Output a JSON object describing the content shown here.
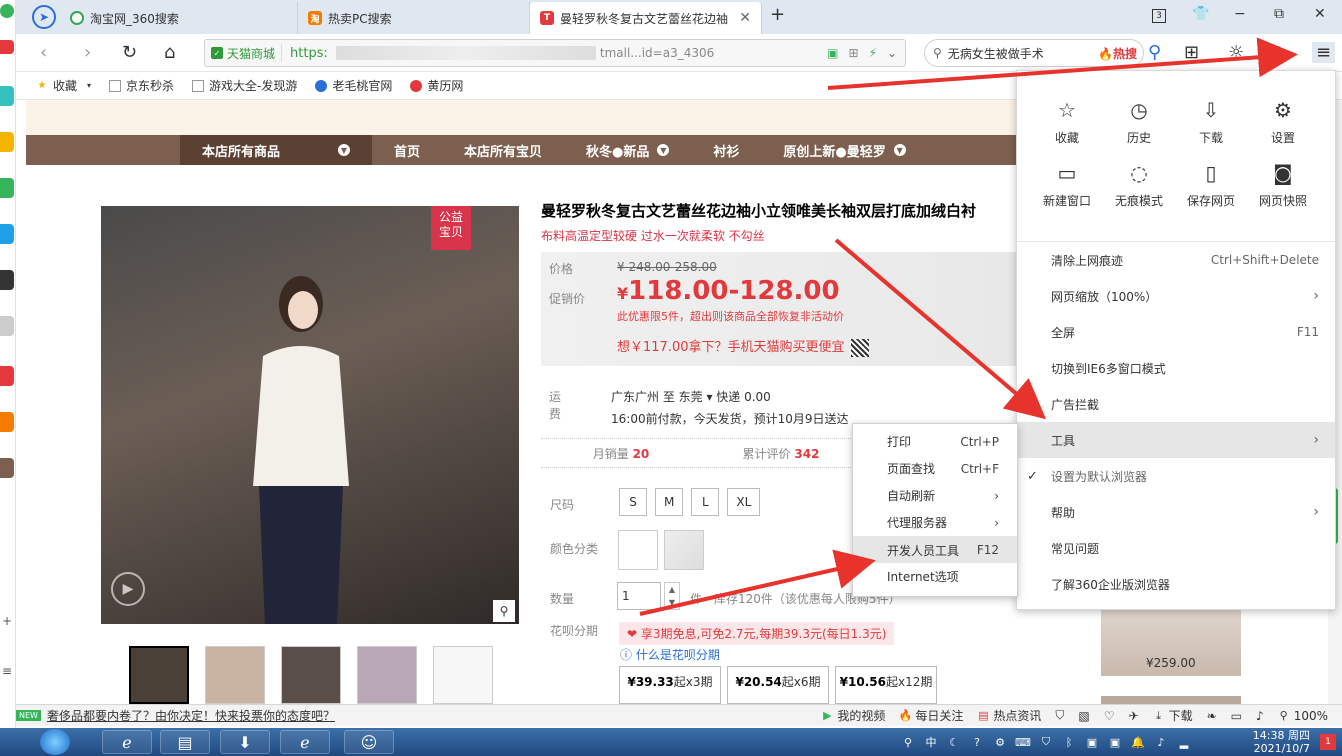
{
  "browser": {
    "tabs": [
      {
        "label": "淘宝网_360搜索",
        "favicon_color": "#34a853"
      },
      {
        "label": "热卖PC搜索",
        "favicon_color": "#f57c00",
        "favicon_text": "淘"
      },
      {
        "label": "曼轻罗秋冬复古文艺蕾丝花边袖",
        "favicon_color": "#e4393c",
        "favicon_text": "T",
        "close": "✕"
      }
    ],
    "new_tab": "+",
    "window_controls": {
      "tab_count": "3",
      "minimize": "−",
      "restore": "⧉",
      "close": "✕"
    },
    "cert_label": "天猫商城",
    "url_prefix": "https:",
    "url_tail": "tmall...id=a3_4306",
    "search_query": "无病女生被做手术",
    "hot_label": "热搜"
  },
  "bookmarks": [
    {
      "label": "收藏",
      "icon": "star-icon"
    },
    {
      "label": "京东秒杀",
      "icon": "page-icon"
    },
    {
      "label": "游戏大全-发现游",
      "icon": "page-icon"
    },
    {
      "label": "老毛桃官网",
      "icon": "globe-icon"
    },
    {
      "label": "黄历网",
      "icon": "calendar-icon"
    }
  ],
  "shop_nav": [
    "本店所有商品",
    "首页",
    "本店所有宝贝",
    "秋冬●新品",
    "衬衫",
    "原创上新●曼轻罗"
  ],
  "product": {
    "badge": [
      "公益",
      "宝贝"
    ],
    "title": "曼轻罗秋冬复古文艺蕾丝花边袖小立领唯美长袖双层打底加绒白衬",
    "subtitle": "布料高温定型较硬 过水一次就柔软 不勾丝",
    "price_label": "价格",
    "old_price": "¥ 248.00-258.00",
    "promo_label": "促销价",
    "currency": "¥",
    "promo_price": "118.00-128.00",
    "limit_text": "此优惠限5件，超出则该商品全部恢复非活动价",
    "app_deal": "想￥117.00拿下？手机天猫购买更便宜",
    "ship_label": "运费",
    "ship_from": "广东广州  至 东莞 ▾  快递 0.00",
    "ship_eta": "16:00前付款，今天发货，预计10月9日送达",
    "monthly_sales_label": "月销量",
    "monthly_sales": "20",
    "reviews_label": "累计评价",
    "reviews": "342",
    "size_label": "尺码",
    "sizes": [
      "S",
      "M",
      "L",
      "XL"
    ],
    "color_label": "颜色分类",
    "qty_label": "数量",
    "qty_value": "1",
    "qty_unit": "件",
    "stock_text": "库存120件（该优惠每人限购5件）",
    "huabei_label": "花呗分期",
    "huabei_offer": "享3期免息,可免2.7元,每期39.3元(每日1.3元)",
    "huabei_help": "什么是花呗分期",
    "installments": [
      {
        "amount": "¥39.33",
        "suffix": "起x3期"
      },
      {
        "amount": "¥20.54",
        "suffix": "起x6期"
      },
      {
        "amount": "¥10.56",
        "suffix": "起x12期"
      }
    ],
    "side_price": "¥259.00"
  },
  "main_menu": {
    "grid": [
      {
        "label": "收藏",
        "icon": "star-icon",
        "glyph": "☆"
      },
      {
        "label": "历史",
        "icon": "clock-icon",
        "glyph": "◷"
      },
      {
        "label": "下载",
        "icon": "download-icon",
        "glyph": "⇩"
      },
      {
        "label": "设置",
        "icon": "gear-icon",
        "glyph": "⚙"
      },
      {
        "label": "新建窗口",
        "icon": "window-icon",
        "glyph": "▭"
      },
      {
        "label": "无痕模式",
        "icon": "incognito-icon",
        "glyph": "◌"
      },
      {
        "label": "保存网页",
        "icon": "save-icon",
        "glyph": "▯"
      },
      {
        "label": "网页快照",
        "icon": "camera-icon",
        "glyph": "◙"
      }
    ],
    "items": [
      {
        "label": "清除上网痕迹",
        "shortcut": "Ctrl+Shift+Delete"
      },
      {
        "label": "网页缩放（100%）",
        "arrow": "›"
      },
      {
        "label": "全屏",
        "shortcut": "F11"
      },
      {
        "label": "切换到IE6多窗口模式"
      },
      {
        "label": "广告拦截"
      },
      {
        "label": "工具",
        "arrow": "›"
      },
      {
        "label": "设置为默认浏览器",
        "check": "✓"
      },
      {
        "label": "帮助",
        "arrow": "›"
      },
      {
        "label": "常见问题"
      },
      {
        "label": "了解360企业版浏览器"
      }
    ]
  },
  "tools_menu": {
    "items": [
      {
        "label": "打印",
        "shortcut": "Ctrl+P"
      },
      {
        "label": "页面查找",
        "shortcut": "Ctrl+F"
      },
      {
        "label": "自动刷新",
        "arrow": "›"
      },
      {
        "label": "代理服务器",
        "arrow": "›"
      },
      {
        "label": "开发人员工具",
        "shortcut": "F12"
      },
      {
        "label": "Internet选项"
      }
    ]
  },
  "status_bar": {
    "new_tag": "NEW",
    "news": "奢侈品都要内卷了？由你决定！快来投票你的态度吧？",
    "items": [
      "我的视频",
      "每日关注",
      "热点资讯"
    ],
    "download": "下载",
    "zoom": "100%"
  },
  "taskbar": {
    "time": "14:38 周四",
    "date": "2021/10/7",
    "ime": "中"
  }
}
